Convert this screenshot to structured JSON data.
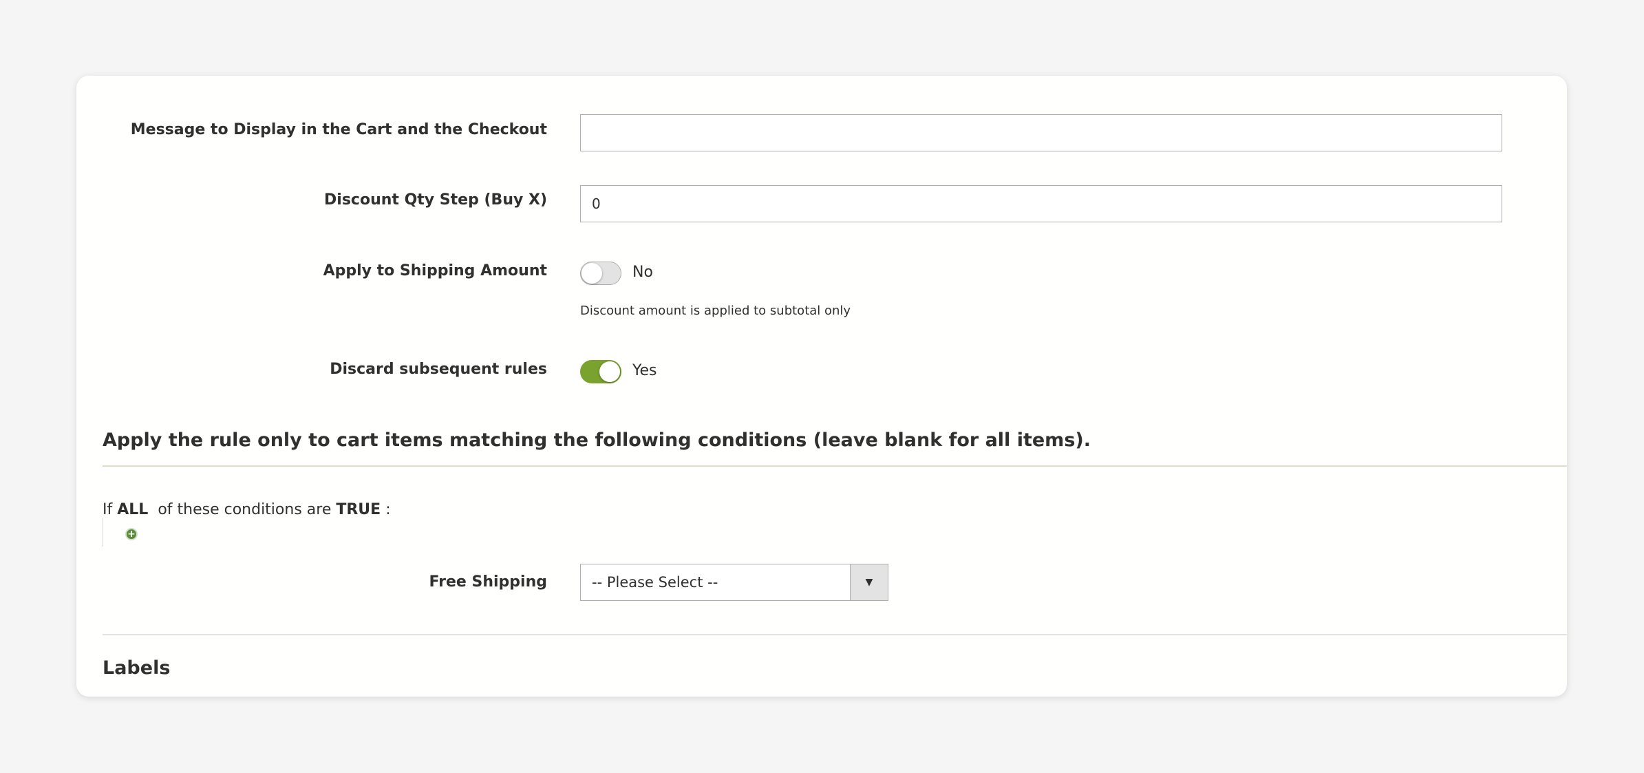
{
  "fields": {
    "message": {
      "label": "Message to Display in the Cart and the Checkout",
      "value": ""
    },
    "qty_step": {
      "label": "Discount Qty Step (Buy X)",
      "value": "0"
    },
    "apply_shipping": {
      "label": "Apply to Shipping Amount",
      "state": "No",
      "note": "Discount amount is applied to subtotal only"
    },
    "discard_rules": {
      "label": "Discard subsequent rules",
      "state": "Yes"
    }
  },
  "conditions": {
    "title": "Apply the rule only to cart items matching the following conditions (leave blank for all items).",
    "prefix": "If",
    "aggregator": "ALL",
    "middle": "of these conditions are",
    "value": "TRUE",
    "suffix": ":",
    "add_icon": "add-condition-icon"
  },
  "free_shipping": {
    "label": "Free Shipping",
    "selected": "-- Please Select --",
    "arrow": "▼"
  },
  "labels_section": {
    "title": "Labels"
  },
  "colors": {
    "toggle_on": "#79a22e",
    "toggle_off": "#e3e3e3",
    "divider_conditions": "#e1dccc",
    "divider_labels": "#e3e3e3"
  }
}
